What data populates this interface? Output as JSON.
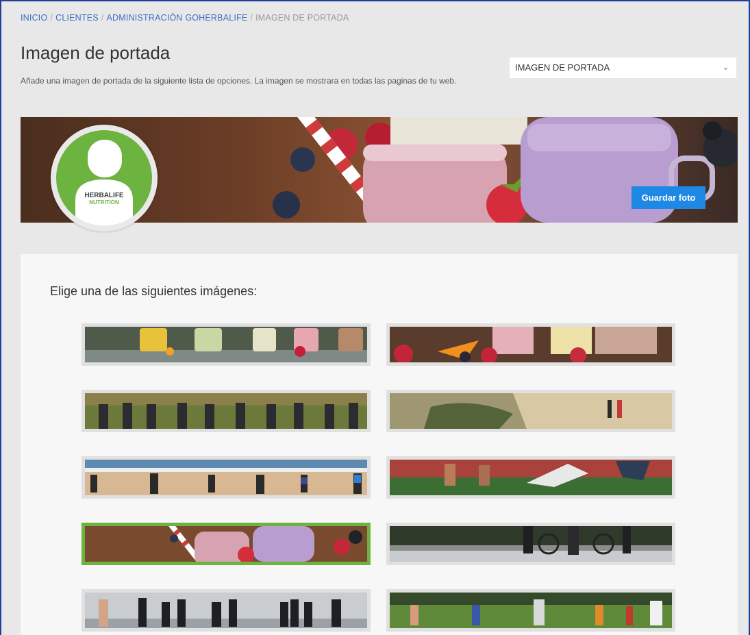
{
  "breadcrumb": {
    "items": [
      "INICIO",
      "CLIENTES",
      "ADMINISTRACIÓN GOHERBALIFE"
    ],
    "separator": "/",
    "current": "IMAGEN DE PORTADA"
  },
  "page": {
    "title": "Imagen de portada",
    "description": "Añade una imagen de portada de la siguiente lista de opciones. La imagen se mostrara en todas las paginas de tu web."
  },
  "select": {
    "value": "IMAGEN DE PORTADA"
  },
  "cover": {
    "save_label": "Guardar foto"
  },
  "logo": {
    "line1": "HERBALIFE",
    "line2": "NUTRITION"
  },
  "gallery": {
    "heading": "Elige una de las siguientes imágenes:",
    "images": [
      {
        "name": "smoothie-bottles",
        "selected": false
      },
      {
        "name": "fruit-shakes",
        "selected": false
      },
      {
        "name": "group-workout-field",
        "selected": false
      },
      {
        "name": "runners-trail",
        "selected": false
      },
      {
        "name": "beach-exercise",
        "selected": false
      },
      {
        "name": "track-sprint-start",
        "selected": false
      },
      {
        "name": "strawberry-shakes",
        "selected": true
      },
      {
        "name": "cyclists-road",
        "selected": false
      },
      {
        "name": "triathlon-swimmers",
        "selected": false
      },
      {
        "name": "park-fitness-class",
        "selected": false
      }
    ]
  },
  "colors": {
    "link": "#3d6fc7",
    "accent": "#1e88e5",
    "brand_green": "#6db33f"
  }
}
